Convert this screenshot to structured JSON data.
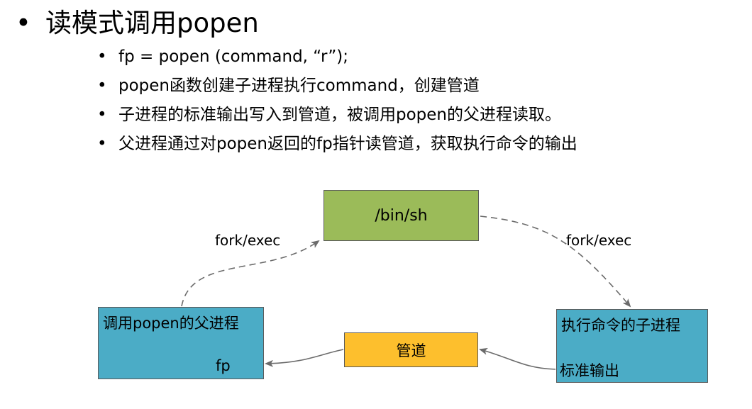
{
  "title": "读模式调用popen",
  "bullets": [
    "fp  =  popen (command, “r”);",
    "popen函数创建子进程执行command，创建管道",
    "子进程的标准输出写入到管道，被调用popen的父进程读取。",
    "父进程通过对popen返回的fp指针读管道，获取执行命令的输出"
  ],
  "diagram": {
    "shell_box": "/bin/sh",
    "pipe_box": "管道",
    "parent_box": {
      "title": "调用popen的父进程",
      "sub": "fp"
    },
    "child_box": {
      "title": "执行命令的子进程",
      "sub": "标准输出"
    },
    "left_arrow_label": "fork/exec",
    "right_arrow_label": "fork/exec"
  },
  "colors": {
    "shell_box": "#9bbb59",
    "pipe_box": "#fdbf2d",
    "process_box": "#4bacc6",
    "arrow": "#6b6b6b"
  }
}
